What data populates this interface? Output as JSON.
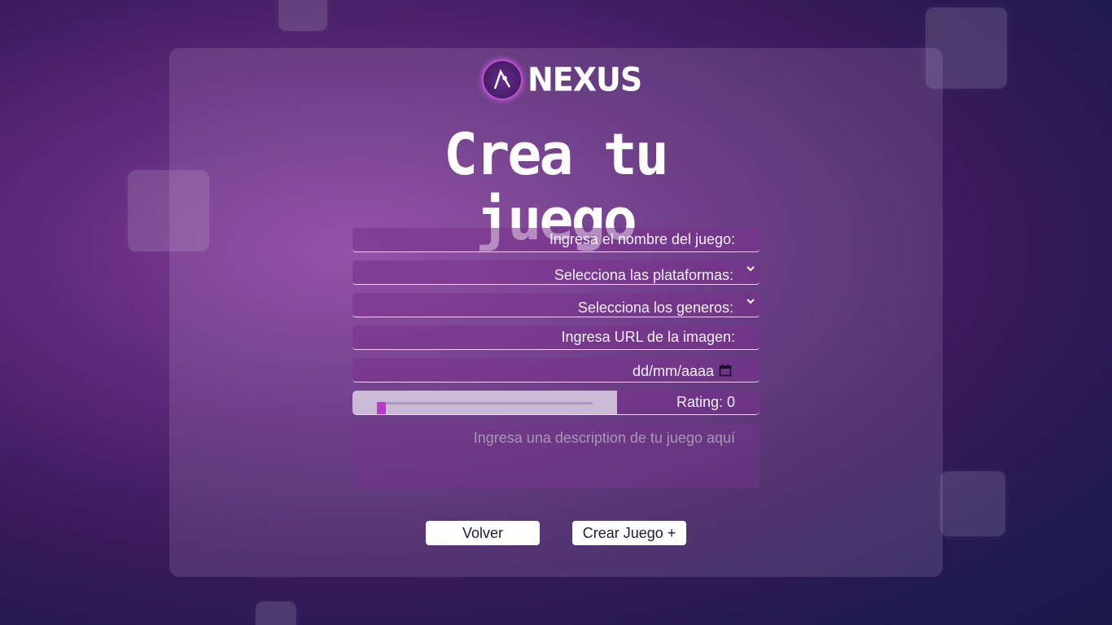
{
  "brand": {
    "name": "NEXUS",
    "logo_icon": "nexus-logo-icon"
  },
  "page": {
    "title": "Crea tu juego"
  },
  "form": {
    "name_placeholder": "Ingresa el nombre del juego:",
    "platforms_label": "Selecciona las plataformas:",
    "genres_label": "Selecciona los generos:",
    "image_url_placeholder": "Ingresa URL de la imagen:",
    "date_placeholder": "dd/mm/aaaa",
    "rating_label": "Rating: 0",
    "rating_value": 0,
    "description_placeholder": "Ingresa una description de tu juego aquí"
  },
  "actions": {
    "back_label": "Volver",
    "create_label": "Crear Juego +"
  },
  "icons": {
    "dropdown": "chevron-down-icon",
    "date": "calendar-icon"
  },
  "colors": {
    "accent": "#b73bc4",
    "button_bg": "#ffffff",
    "text": "#f4eefa"
  }
}
